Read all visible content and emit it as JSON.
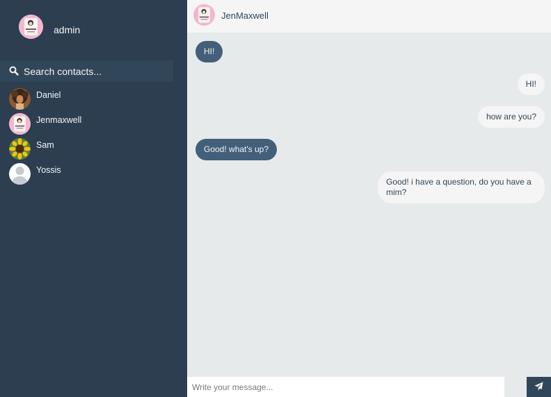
{
  "sidebar": {
    "profile": {
      "name": "admin",
      "avatar_icon": "pink-logo-avatar"
    },
    "search": {
      "placeholder": "Search contacts...",
      "icon": "search-icon"
    },
    "contacts": [
      {
        "name": "Daniel",
        "avatar_icon": "curly-hair-photo"
      },
      {
        "name": "Jenmaxwell",
        "avatar_icon": "pink-logo-avatar"
      },
      {
        "name": "Sam",
        "avatar_icon": "sunflower-photo"
      },
      {
        "name": "Yossis",
        "avatar_icon": "default-user-avatar"
      }
    ]
  },
  "chat": {
    "header": {
      "name": "JenMaxwell",
      "avatar_icon": "pink-logo-avatar"
    },
    "messages": [
      {
        "direction": "incoming",
        "text": "HI!"
      },
      {
        "direction": "outgoing",
        "text": "HI!"
      },
      {
        "direction": "outgoing",
        "text": "how are you?"
      },
      {
        "direction": "incoming",
        "text": "Good! what's up?"
      },
      {
        "direction": "outgoing",
        "text": "Good! i have a question, do you have a mim?"
      }
    ],
    "composer": {
      "placeholder": "Write your message...",
      "send_icon": "paper-plane-icon"
    }
  },
  "colors": {
    "sidebar_bg": "#2c3e50",
    "search_bg": "#32465a",
    "chat_bg": "#e6eaea",
    "incoming_bubble": "#435f7a",
    "outgoing_bubble": "#f5f5f5",
    "send_button": "#32465a"
  }
}
